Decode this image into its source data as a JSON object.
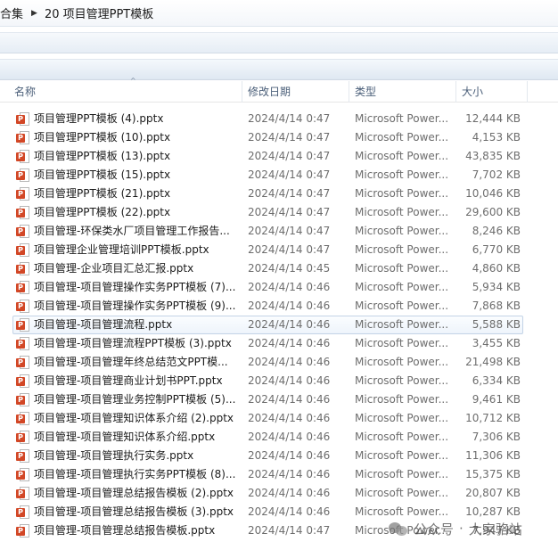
{
  "breadcrumb": {
    "parent": "合集",
    "separator": "▶",
    "current": "20 项目管理PPT模板"
  },
  "columns": {
    "name": "名称",
    "date": "修改日期",
    "type": "类型",
    "size": "大小",
    "sort_indicator": "^"
  },
  "file_icon": "powerpoint-file-icon",
  "files": [
    {
      "name": "项目管理PPT模板 (4).pptx",
      "date": "2024/4/14 0:47",
      "type": "Microsoft Power...",
      "size": "12,444 KB"
    },
    {
      "name": "项目管理PPT模板 (10).pptx",
      "date": "2024/4/14 0:47",
      "type": "Microsoft Power...",
      "size": "4,153 KB"
    },
    {
      "name": "项目管理PPT模板 (13).pptx",
      "date": "2024/4/14 0:47",
      "type": "Microsoft Power...",
      "size": "43,835 KB"
    },
    {
      "name": "项目管理PPT模板 (15).pptx",
      "date": "2024/4/14 0:47",
      "type": "Microsoft Power...",
      "size": "7,702 KB"
    },
    {
      "name": "项目管理PPT模板 (21).pptx",
      "date": "2024/4/14 0:47",
      "type": "Microsoft Power...",
      "size": "10,046 KB"
    },
    {
      "name": "项目管理PPT模板 (22).pptx",
      "date": "2024/4/14 0:47",
      "type": "Microsoft Power...",
      "size": "29,600 KB"
    },
    {
      "name": "项目管理-环保类水厂项目管理工作报告...",
      "date": "2024/4/14 0:47",
      "type": "Microsoft Power...",
      "size": "8,246 KB"
    },
    {
      "name": "项目管理企业管理培训PPT模板.pptx",
      "date": "2024/4/14 0:47",
      "type": "Microsoft Power...",
      "size": "6,770 KB"
    },
    {
      "name": "项目管理-企业项目汇总汇报.pptx",
      "date": "2024/4/14 0:45",
      "type": "Microsoft Power...",
      "size": "4,860 KB"
    },
    {
      "name": "项目管理-项目管理操作实务PPT模板 (7)....",
      "date": "2024/4/14 0:46",
      "type": "Microsoft Power...",
      "size": "5,934 KB"
    },
    {
      "name": "项目管理-项目管理操作实务PPT模板 (9)....",
      "date": "2024/4/14 0:46",
      "type": "Microsoft Power...",
      "size": "7,868 KB"
    },
    {
      "name": "项目管理-项目管理流程.pptx",
      "date": "2024/4/14 0:46",
      "type": "Microsoft Power...",
      "size": "5,588 KB",
      "selected": true
    },
    {
      "name": "项目管理-项目管理流程PPT模板 (3).pptx",
      "date": "2024/4/14 0:46",
      "type": "Microsoft Power...",
      "size": "3,455 KB"
    },
    {
      "name": "项目管理-项目管理年终总结范文PPT模...",
      "date": "2024/4/14 0:46",
      "type": "Microsoft Power...",
      "size": "21,498 KB"
    },
    {
      "name": "项目管理-项目管理商业计划书PPT.pptx",
      "date": "2024/4/14 0:46",
      "type": "Microsoft Power...",
      "size": "6,334 KB"
    },
    {
      "name": "项目管理-项目管理业务控制PPT模板 (5)....",
      "date": "2024/4/14 0:46",
      "type": "Microsoft Power...",
      "size": "9,461 KB"
    },
    {
      "name": "项目管理-项目管理知识体系介绍 (2).pptx",
      "date": "2024/4/14 0:46",
      "type": "Microsoft Power...",
      "size": "10,712 KB"
    },
    {
      "name": "项目管理-项目管理知识体系介绍.pptx",
      "date": "2024/4/14 0:46",
      "type": "Microsoft Power...",
      "size": "7,306 KB"
    },
    {
      "name": "项目管理-项目管理执行实务.pptx",
      "date": "2024/4/14 0:46",
      "type": "Microsoft Power...",
      "size": "11,306 KB"
    },
    {
      "name": "项目管理-项目管理执行实务PPT模板 (8)....",
      "date": "2024/4/14 0:46",
      "type": "Microsoft Power...",
      "size": "15,375 KB"
    },
    {
      "name": "项目管理-项目管理总结报告模板 (2).pptx",
      "date": "2024/4/14 0:46",
      "type": "Microsoft Power...",
      "size": "20,807 KB"
    },
    {
      "name": "项目管理-项目管理总结报告模板 (3).pptx",
      "date": "2024/4/14 0:46",
      "type": "Microsoft Power...",
      "size": "10,287 KB"
    },
    {
      "name": "项目管理-项目管理总结报告模板.pptx",
      "date": "2024/4/14 0:47",
      "type": "Microsoft Power...",
      "size": "7,947 KB"
    }
  ],
  "watermark": {
    "icon": "wechat-icon",
    "text": "公众号",
    "separator": "·",
    "author": "大家骆站"
  }
}
